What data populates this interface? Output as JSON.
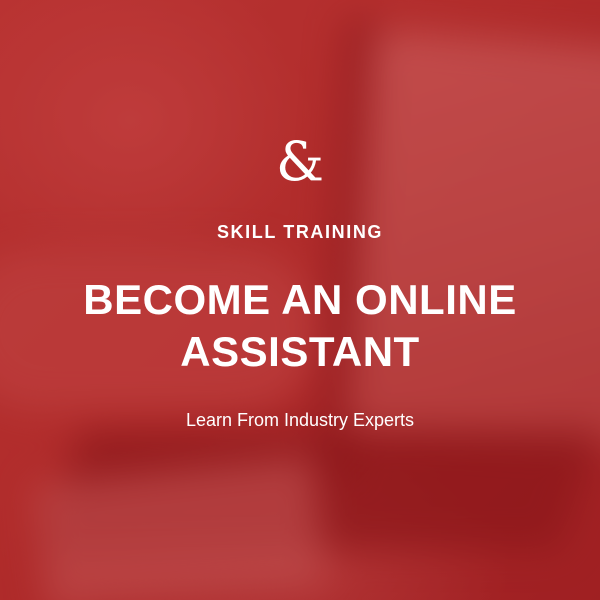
{
  "brand": {
    "logo_glyph": "&"
  },
  "kicker": "SKILL TRAINING",
  "headline": {
    "line1": "BECOME AN ONLINE",
    "line2": "ASSISTANT"
  },
  "subtitle": "Learn From Industry Experts",
  "colors": {
    "background_tint": "#b5302f",
    "text": "#ffffff"
  }
}
